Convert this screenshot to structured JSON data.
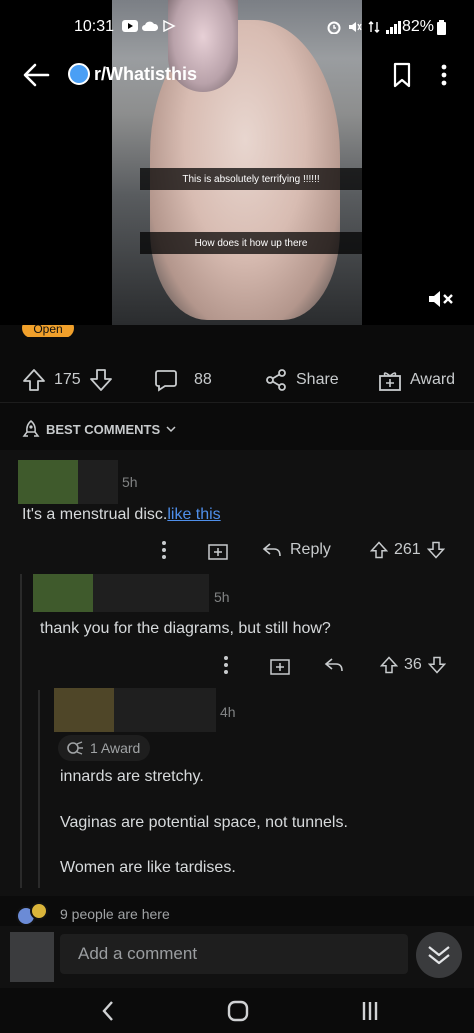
{
  "status_bar": {
    "time": "10:31",
    "battery": "82%"
  },
  "header": {
    "subreddit": "r/Whatisthis"
  },
  "video": {
    "caption_1": "This is absolutely terrifying !!!!!!",
    "caption_2": "How does it how up there"
  },
  "post": {
    "flair": "Open"
  },
  "actions": {
    "upvotes": "175",
    "comments": "88",
    "share": "Share",
    "award": "Award"
  },
  "sort": {
    "label": "BEST COMMENTS"
  },
  "comments": [
    {
      "time": "5h",
      "text": "It's a menstrual disc.",
      "link": "like this ",
      "reply": "Reply",
      "score": "261",
      "avatar_color": "#3f5a2c"
    },
    {
      "time": "5h",
      "text": "thank you for the diagrams, but still how?",
      "score": "36",
      "avatar_color": "#3f5a2c"
    },
    {
      "time": "4h",
      "award": "1 Award",
      "paragraphs": [
        "innards are stretchy.",
        "Vaginas are potential space, not tunnels.",
        "Women are like tardises."
      ],
      "avatar_color": "#4f4628"
    }
  ],
  "presence": "9 people are here",
  "composer": {
    "placeholder": "Add a comment"
  }
}
